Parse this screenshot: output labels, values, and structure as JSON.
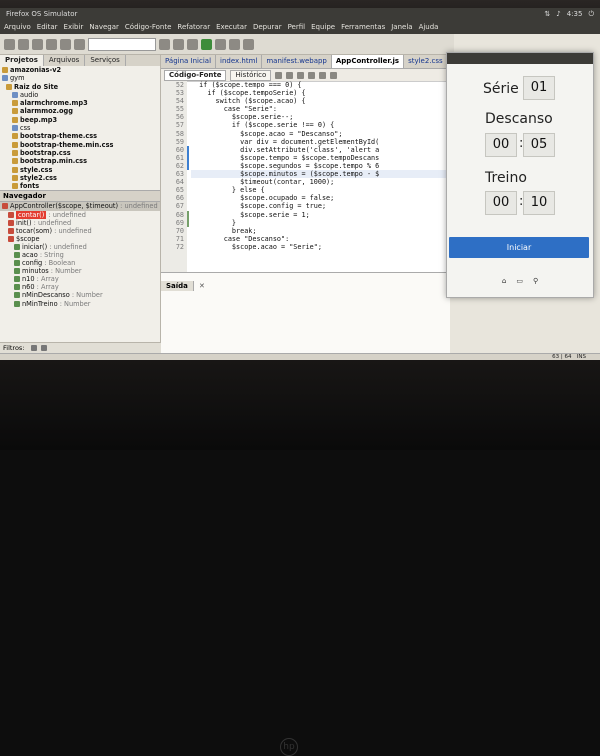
{
  "os_panel": {
    "title": "Firefox OS Simulator",
    "clock": "4:35"
  },
  "menu": [
    "Arquivo",
    "Editar",
    "Exibir",
    "Navegar",
    "Código-Fonte",
    "Refatorar",
    "Executar",
    "Depurar",
    "Perfil",
    "Equipe",
    "Ferramentas",
    "Janela",
    "Ajuda"
  ],
  "toolbar": {
    "config": ""
  },
  "left_tabs": [
    "Projetos",
    "Arquivos",
    "Serviços"
  ],
  "tree": [
    {
      "text": "amazonias-v2",
      "b": true
    },
    {
      "text": "gym",
      "b": false
    },
    {
      "text": "Raiz do Site",
      "b": true
    },
    {
      "text": "audio",
      "b": false
    },
    {
      "text": "alarmchrome.mp3",
      "b": true
    },
    {
      "text": "alarmmoz.ogg",
      "b": true
    },
    {
      "text": "beep.mp3",
      "b": true
    },
    {
      "text": "css",
      "b": false
    },
    {
      "text": "bootstrap-theme.css",
      "b": true
    },
    {
      "text": "bootstrap-theme.min.css",
      "b": true
    },
    {
      "text": "bootstrap.css",
      "b": true
    },
    {
      "text": "bootstrap.min.css",
      "b": true
    },
    {
      "text": "style.css",
      "b": true
    },
    {
      "text": "style2.css",
      "b": true
    },
    {
      "text": "fonts",
      "b": true
    }
  ],
  "navigator": {
    "title": "Navegador",
    "items": [
      {
        "name": "AppController($scope, $timeout)",
        "type": " : undefined"
      },
      {
        "name": "contar()",
        "type": " : undefined",
        "hl": true
      },
      {
        "name": "init()",
        "type": " : undefined"
      },
      {
        "name": "tocar(som)",
        "type": " : undefined"
      },
      {
        "name": "$scope",
        "type": ""
      },
      {
        "name": "iniciar()",
        "type": " : undefined"
      },
      {
        "name": "acao",
        "type": " : String"
      },
      {
        "name": "config",
        "type": " : Boolean"
      },
      {
        "name": "minutos",
        "type": " : Number"
      },
      {
        "name": "n10",
        "type": " : Array"
      },
      {
        "name": "n60",
        "type": " : Array"
      },
      {
        "name": "nMinDescanso",
        "type": " : Number"
      },
      {
        "name": "nMinTreino",
        "type": " : Number"
      }
    ]
  },
  "filter_label": "Filtros:",
  "editor": {
    "tabs": [
      "Página Inicial",
      "index.html",
      "manifest.webapp",
      "AppController.js",
      "style2.css"
    ],
    "active_tab": 3,
    "subtabs": [
      "Código-Fonte",
      "Histórico"
    ],
    "gutter": [
      "52",
      "53",
      "54",
      "55",
      "56",
      "57",
      "58",
      "59",
      "60",
      "61",
      "62",
      "63",
      "64",
      "65",
      "66",
      "67",
      "68",
      "69",
      "70",
      "71",
      "72"
    ],
    "lines": [
      "  if ($scope.tempo === 0) {",
      "    if ($scope.tempoSerie) {",
      "      switch ($scope.acao) {",
      "        case \"Serie\":",
      "          $scope.serie--;",
      "          if ($scope.serie !== 0) {",
      "            $scope.acao = \"Descanso\";",
      "            var div = document.getElementById(",
      "            div.setAttribute('class', 'alert a",
      "            $scope.tempo = $scope.tempoDescans",
      "            $scope.segundos = $scope.tempo % 6",
      "            $scope.minutos = ($scope.tempo - $",
      "            $timeout(contar, 1000);",
      "          } else {",
      "            $scope.ocupado = false;",
      "            $scope.config = true;",
      "            $scope.serie = 1;",
      "          }",
      "          break;",
      "        case \"Descanso\":",
      "          $scope.acao = \"Serie\";"
    ]
  },
  "output_tab": "Saída",
  "status": {
    "position": "63 | 64",
    "mode": "INS"
  },
  "app": {
    "serie_label": "Série",
    "serie_value": "01",
    "descanso_label": "Descanso",
    "descanso_min": "00",
    "descanso_sec": "05",
    "treino_label": "Treino",
    "treino_min": "00",
    "treino_sec": "10",
    "start_label": "Iniciar"
  }
}
